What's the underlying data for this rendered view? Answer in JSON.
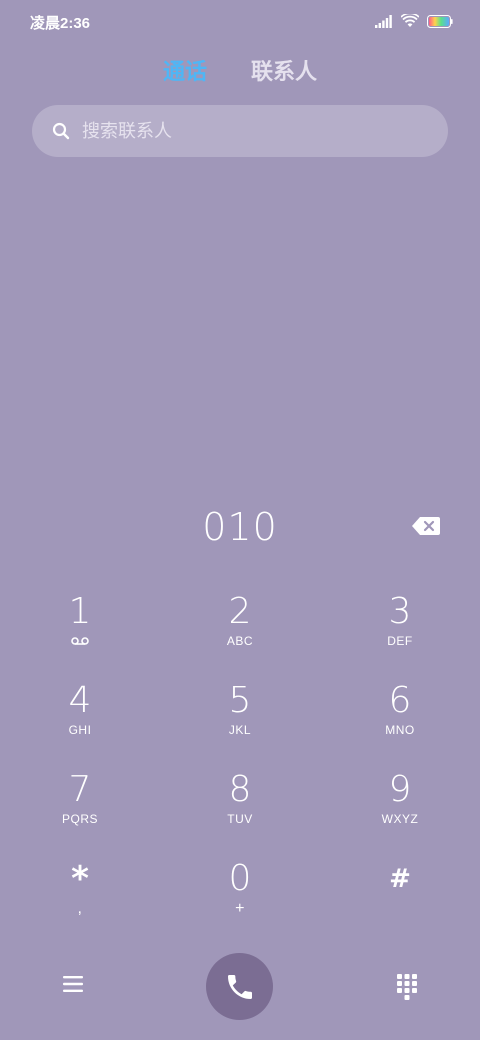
{
  "status_bar": {
    "time": "凌晨2:36",
    "icons": [
      "signal-icon",
      "wifi-icon",
      "battery-icon"
    ]
  },
  "tabs": [
    {
      "label": "通话",
      "active": true
    },
    {
      "label": "联系人",
      "active": false
    }
  ],
  "search": {
    "placeholder": "搜索联系人",
    "icon": "search-icon"
  },
  "dialer": {
    "number": "010",
    "backspace_icon": "backspace-icon"
  },
  "keypad": [
    {
      "digit": "1",
      "sub": ""
    },
    {
      "digit": "2",
      "sub": "ABC"
    },
    {
      "digit": "3",
      "sub": "DEF"
    },
    {
      "digit": "4",
      "sub": "GHI"
    },
    {
      "digit": "5",
      "sub": "JKL"
    },
    {
      "digit": "6",
      "sub": "MNO"
    },
    {
      "digit": "7",
      "sub": "PQRS"
    },
    {
      "digit": "8",
      "sub": "TUV"
    },
    {
      "digit": "9",
      "sub": "WXYZ"
    },
    {
      "digit": "*",
      "sub": ","
    },
    {
      "digit": "0",
      "sub": "+"
    },
    {
      "digit": "#",
      "sub": ""
    }
  ],
  "bottom_bar": {
    "menu_icon": "menu-icon",
    "call_icon": "phone-icon",
    "keypad_icon": "dialpad-icon"
  },
  "colors": {
    "background": "#a097b9",
    "active_tab": "#4fb6f5",
    "call_button": "#7b6d93",
    "search_bg": "#b5aec9"
  }
}
